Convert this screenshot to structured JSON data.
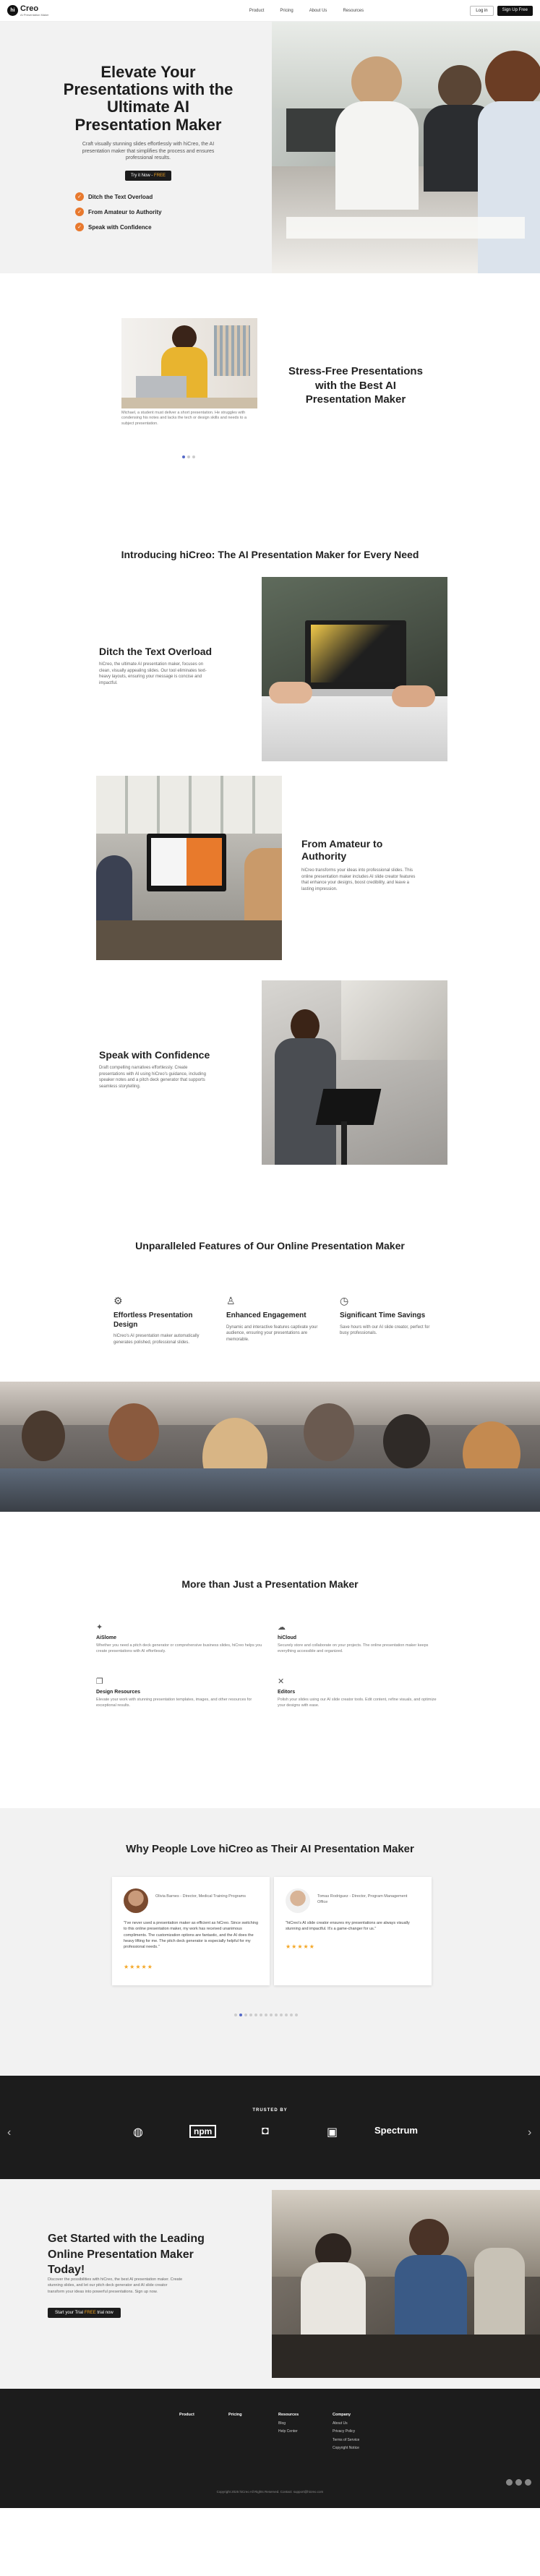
{
  "header": {
    "logo_text": "Creo",
    "logo_sub": "AI Presentation Maker",
    "nav": [
      "Product",
      "Pricing",
      "About Us",
      "Resources"
    ],
    "login": "Log in",
    "signup": "Sign Up Free"
  },
  "hero": {
    "title": "Elevate Your Presentations with the Ultimate AI Presentation Maker",
    "desc": "Craft visually stunning slides effortlessly with hiCreo, the AI presentation maker that simplifies the process and ensures professional results.",
    "cta_prefix": "Try it Now - ",
    "cta_free": "FREE",
    "features": [
      "Ditch the Text Overload",
      "From Amateur to Authority",
      "Speak with Confidence"
    ]
  },
  "stress": {
    "caption": "Michael, a student must deliver a short presentation. He struggles with condensing his notes and lacks the tech or design skills and needs to a subject presentation.",
    "title": "Stress-Free Presentations with the Best AI Presentation Maker"
  },
  "intro_title": "Introducing hiCreo: The AI Presentation Maker for Every Need",
  "rows": [
    {
      "title": "Ditch the Text Overload",
      "desc": "hiCreo, the ultimate AI presentation maker, focuses on clean, visually appealing slides. Our tool eliminates text-heavy layouts, ensuring your message is concise and impactful."
    },
    {
      "title": "From Amateur to Authority",
      "desc": "hiCreo transforms your ideas into professional slides. This online presentation maker includes AI slide creator features that enhance your designs, boost credibility, and leave a lasting impression."
    },
    {
      "title": "Speak with Confidence",
      "desc": "Draft compelling narratives effortlessly. Create presentations with AI using hiCreo's guidance, including speaker notes and a pitch deck generator that supports seamless storytelling."
    }
  ],
  "unparalleled": {
    "title": "Unparalleled Features of Our Online Presentation Maker",
    "cards": [
      {
        "title": "Effortless Presentation Design",
        "desc": "hiCreo's AI presentation maker automatically generates polished, professional slides."
      },
      {
        "title": "Enhanced Engagement",
        "desc": "Dynamic and interactive features captivate your audience, ensuring your presentations are memorable."
      },
      {
        "title": "Significant Time Savings",
        "desc": "Save hours with our AI slide creator, perfect for busy professionals."
      }
    ]
  },
  "more": {
    "title": "More than Just a Presentation Maker",
    "items": [
      {
        "title": "AiSlome",
        "desc": "Whether you need a pitch deck generator or comprehensive business slides, hiCreo helps you create presentations with AI effortlessly."
      },
      {
        "title": "hiCloud",
        "desc": "Securely store and collaborate on your projects. The online presentation maker keeps everything accessible and organized."
      },
      {
        "title": "Design Resources",
        "desc": "Elevate your work with stunning presentation templates, images, and other resources for exceptional results."
      },
      {
        "title": "Editors",
        "desc": "Polish your slides using our AI slide creator tools. Edit content, refine visuals, and optimize your designs with ease."
      }
    ]
  },
  "why": {
    "title": "Why People Love hiCreo as Their AI Presentation Maker",
    "testimonials": [
      {
        "name": "Olivia Barnes - Director, Medical Training Programs",
        "quote": "\"I've never used a presentation maker as efficient as hiCreo. Since switching to this online presentation maker, my work has received unanimous compliments. The customization options are fantastic, and the AI does the heavy lifting for me. The pitch deck generator is especially helpful for my professional needs.\"",
        "stars": "★★★★★"
      },
      {
        "name": "Tomas Rodriguez - Director, Program Management Office",
        "quote": "\"hiCreo's AI slide creator ensures my presentations are always visually stunning and impactful. It's a game-changer for us.\"",
        "stars": "★★★★★"
      }
    ]
  },
  "trusted": {
    "label": "TRUSTED BY",
    "logos": [
      "npm",
      "Spectrum"
    ]
  },
  "cta": {
    "title": "Get Started with the Leading Online Presentation Maker Today!",
    "desc": "Discover the possibilities with hiCreo, the best AI presentation maker. Create stunning slides, and let our pitch deck generator and AI slide creator transform your ideas into powerful presentations. Sign up now.",
    "btn_prefix": "Start your Trial ",
    "btn_free": "FREE",
    "btn_suffix": " trial now"
  },
  "footer": {
    "cols": [
      {
        "title": "Product",
        "links": []
      },
      {
        "title": "Pricing",
        "links": []
      },
      {
        "title": "Resources",
        "links": [
          "Blog",
          "Help Center"
        ]
      },
      {
        "title": "Company",
        "links": [
          "About Us",
          "Privacy Policy",
          "Terms of Service",
          "Copyright Notice"
        ]
      }
    ],
    "copyright": "Copyright 2025 hiCreo All Rights Reserved. Contact: support@hicreo.com"
  }
}
